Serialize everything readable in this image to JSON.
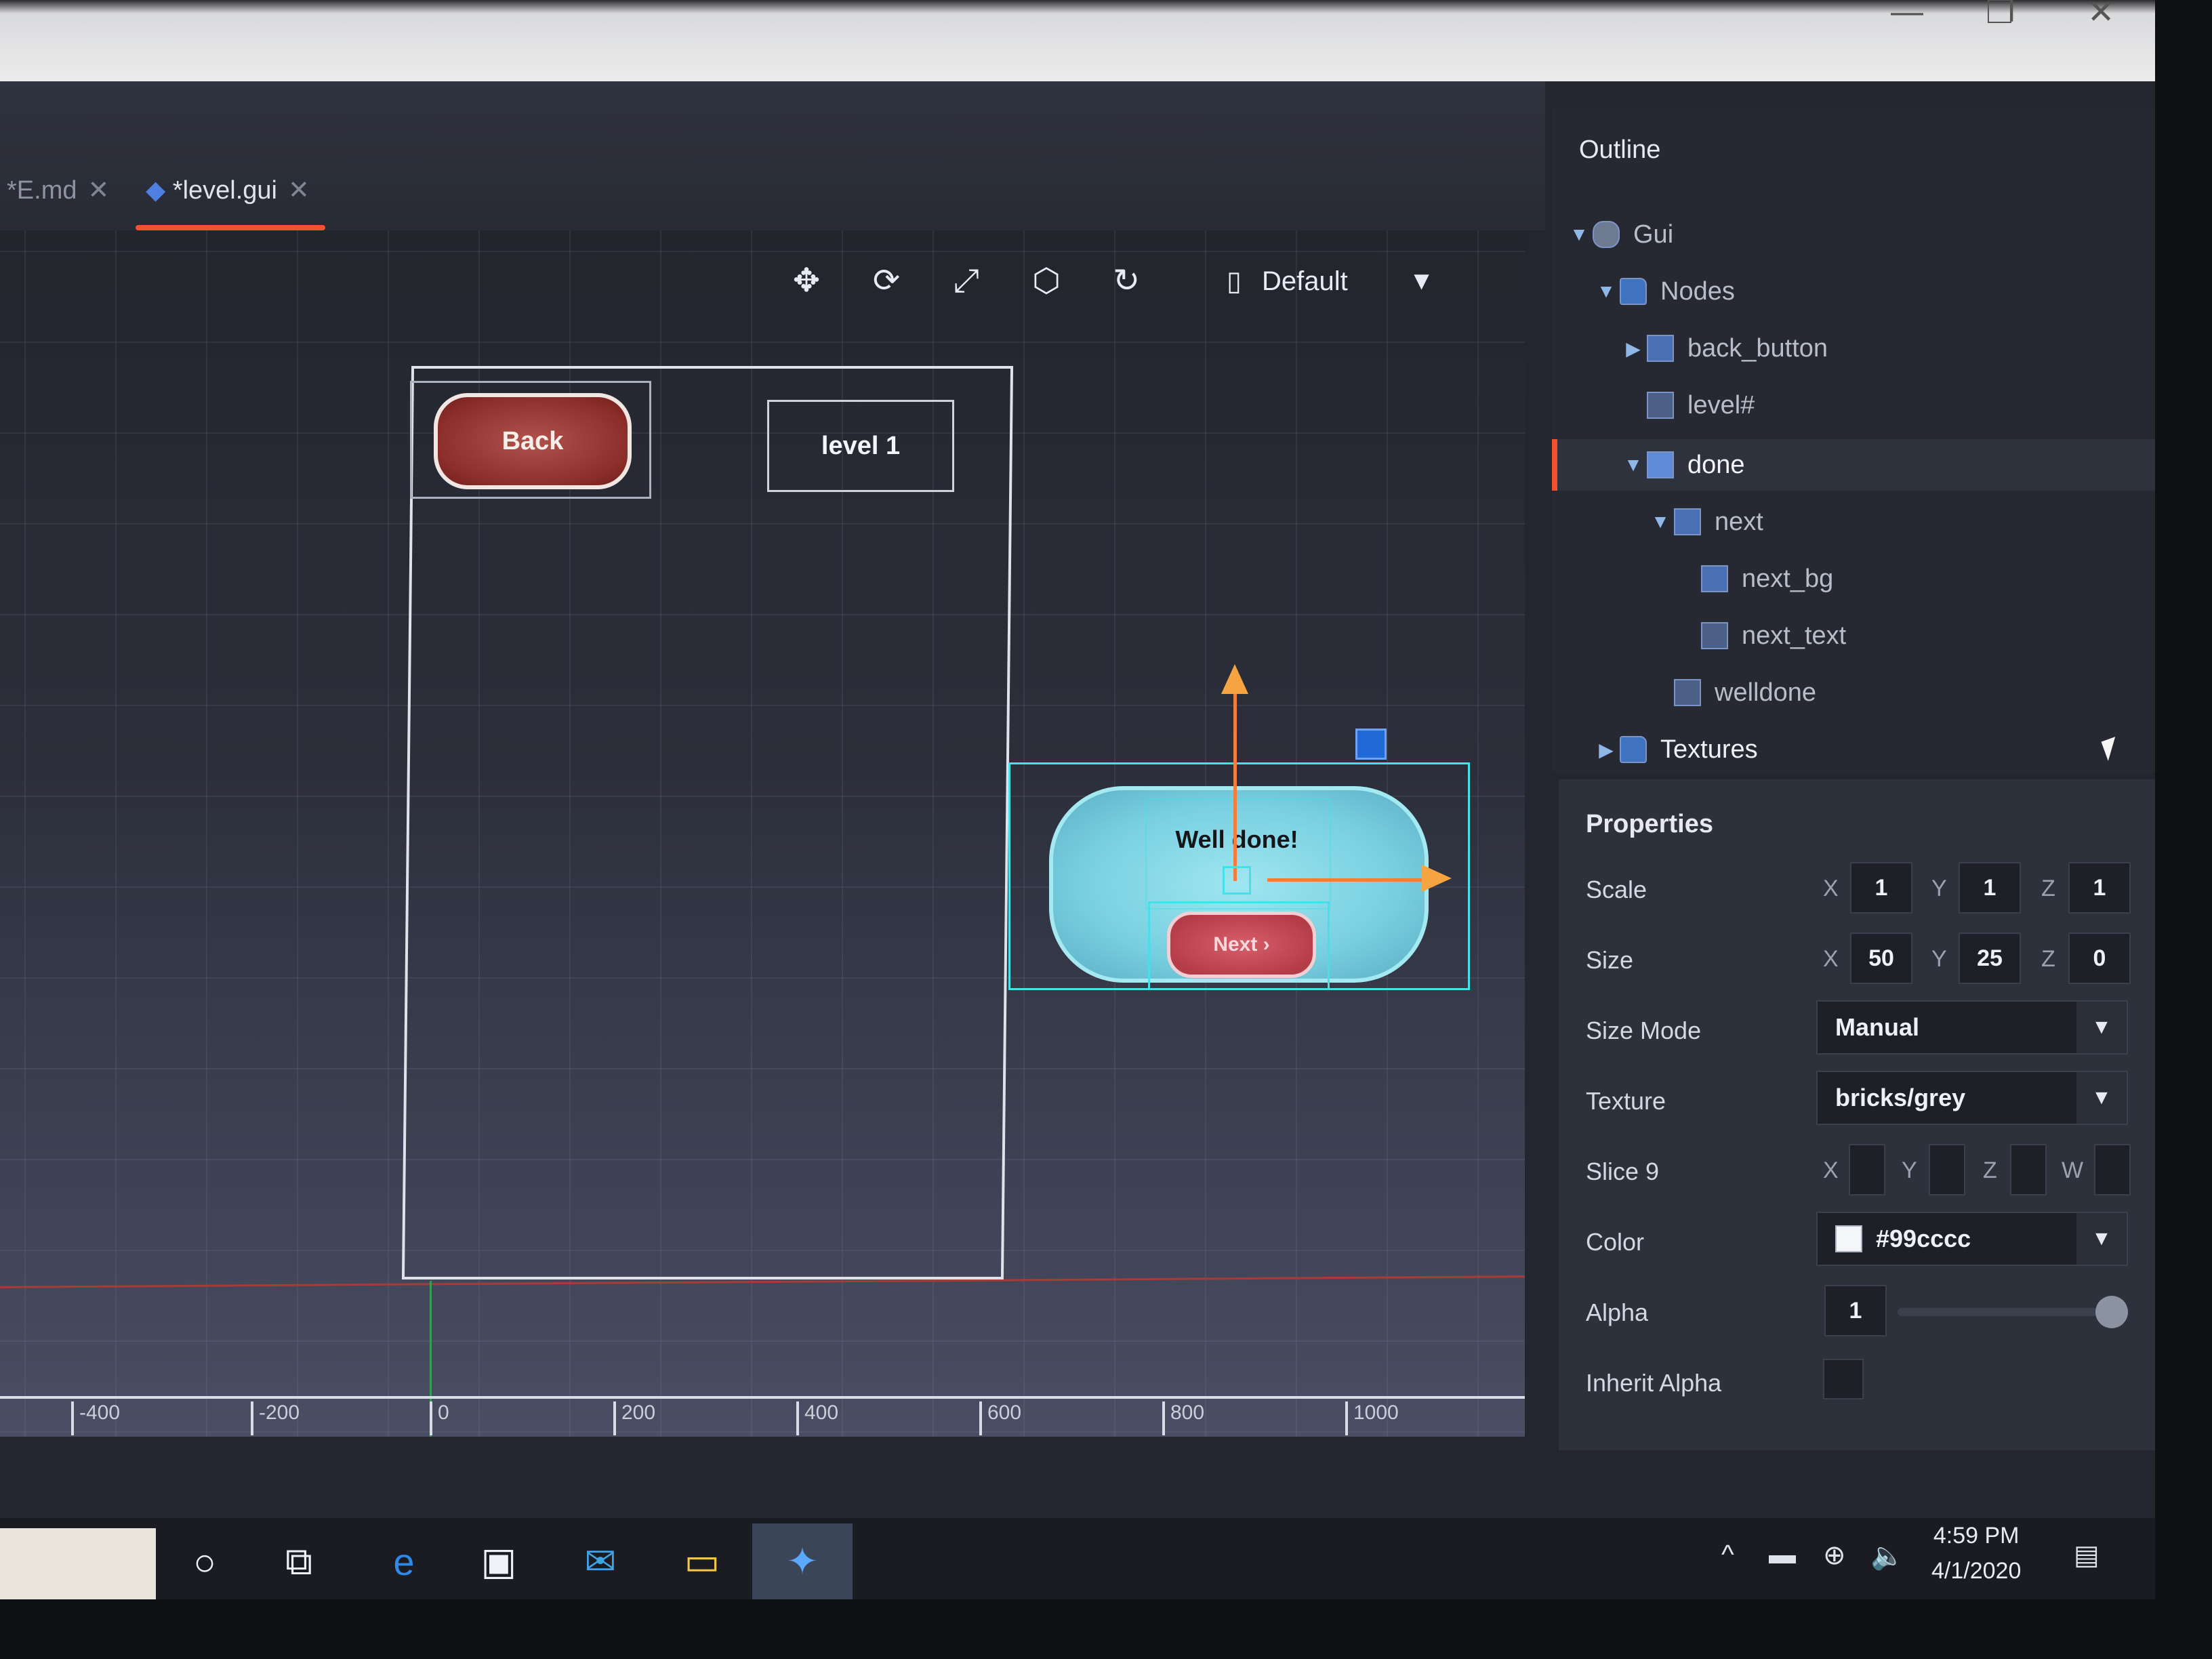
{
  "tabs": [
    {
      "label": "*E.md",
      "close": "✕"
    },
    {
      "label": "*level.gui",
      "close": "✕"
    }
  ],
  "toolbar": {
    "tools": [
      "move-icon",
      "rotate-icon",
      "scale-icon",
      "resize-icon",
      "anchor-icon"
    ],
    "layout_label": "Default",
    "layout_caret": "▼"
  },
  "scene": {
    "back_button_text": "Back",
    "level_text": "level 1",
    "welldone_text": "Well done!",
    "next_text": "Next ›",
    "ruler_ticks": [
      "-400",
      "-200",
      "0",
      "200",
      "400",
      "600",
      "800",
      "1000"
    ]
  },
  "outline": {
    "title": "Outline",
    "nodes": [
      {
        "label": "Gui",
        "arrow": "▼"
      },
      {
        "label": "Nodes",
        "arrow": "▼"
      },
      {
        "label": "back_button",
        "arrow": "▶"
      },
      {
        "label": "level#",
        "arrow": ""
      },
      {
        "label": "done",
        "arrow": "▼"
      },
      {
        "label": "next",
        "arrow": "▼"
      },
      {
        "label": "next_bg",
        "arrow": ""
      },
      {
        "label": "next_text",
        "arrow": ""
      },
      {
        "label": "welldone",
        "arrow": ""
      },
      {
        "label": "Textures",
        "arrow": "▶"
      }
    ]
  },
  "properties": {
    "title": "Properties",
    "scale": {
      "label": "Scale",
      "x": "1",
      "y": "1",
      "z": "1"
    },
    "size": {
      "label": "Size",
      "x": "50",
      "y": "25",
      "z": "0"
    },
    "size_mode": {
      "label": "Size Mode",
      "value": "Manual"
    },
    "texture": {
      "label": "Texture",
      "value": "bricks/grey"
    },
    "slice9": {
      "label": "Slice 9",
      "axes": [
        "X",
        "Y",
        "Z",
        "W"
      ]
    },
    "color": {
      "label": "Color",
      "value": "#99cccc"
    },
    "alpha": {
      "label": "Alpha",
      "value": "1"
    },
    "inherit_alpha": {
      "label": "Inherit Alpha"
    }
  },
  "axis_labels": {
    "x": "X",
    "y": "Y",
    "z": "Z"
  },
  "dropdown_caret": "▼",
  "taskbar": {
    "time": "4:59 PM",
    "date": "4/1/2020"
  },
  "window_controls": [
    "—",
    "❐",
    "✕"
  ]
}
